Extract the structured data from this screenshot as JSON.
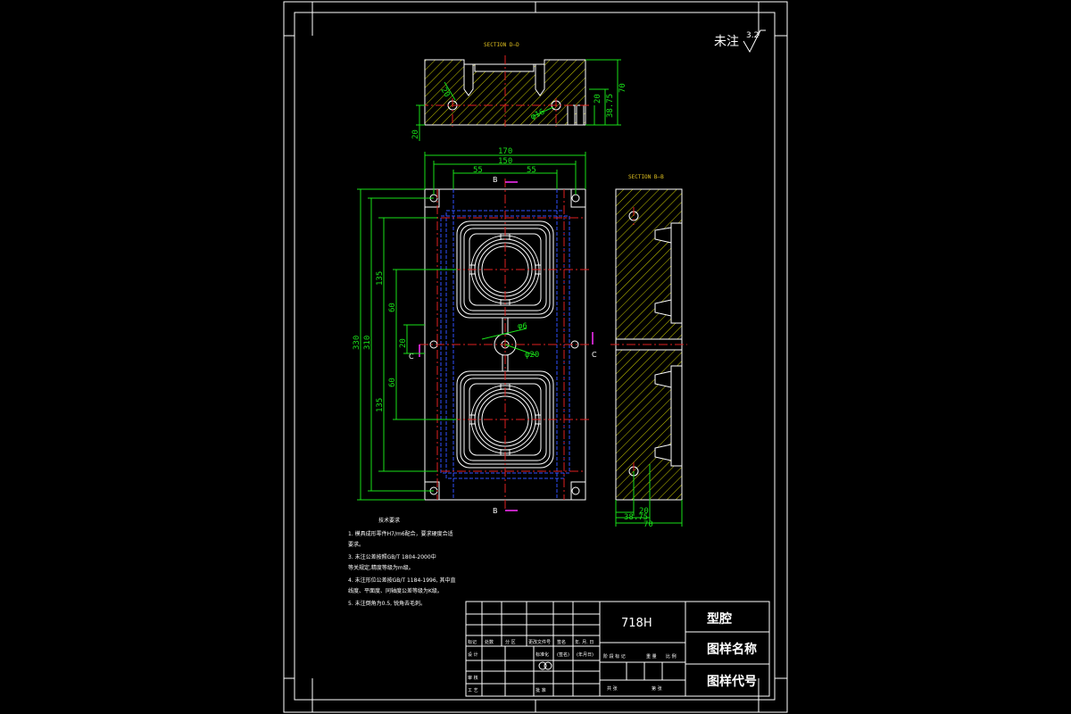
{
  "roughness": {
    "label": "未注",
    "value": "3.2"
  },
  "sections": {
    "dd": "SECTION D—D",
    "bb": "SECTION B—B"
  },
  "cut_marks": {
    "b": "B",
    "c": "C"
  },
  "dims": {
    "d170": "170",
    "d150": "150",
    "d55a": "55",
    "d55b": "55",
    "d330": "330",
    "d310": "310",
    "d135a": "135",
    "d135b": "135",
    "d60a": "60",
    "d60b": "60",
    "d20v": "20",
    "phi6": "φ6",
    "phi20": "φ20",
    "top70": "70",
    "top38": "38.75",
    "top20a": "20",
    "top20b": "20",
    "topphi": "φ16",
    "r20": "20",
    "bot20": "20",
    "bot38": "38.75",
    "bot70": "70"
  },
  "notes": {
    "title": "技术要求",
    "lines": [
      "1. 模具成形零件H7/m6配合，要求硬度合适",
      "   要求。",
      "3. 未注公差按照GB/T 1804-2000中",
      "   等关规定,精度等级为m级。",
      "4. 未注形位公差按GB/T 1184-1996, 其中直",
      "   线度、平面度、同轴度公差等级为K级。",
      "5. 未注倒角为0.5, 锐角去毛刺。"
    ]
  },
  "title_block": {
    "material": "718H",
    "part_name": "型腔",
    "drawing_name_label": "图样名称",
    "drawing_code_label": "图样代号",
    "header_row": [
      "标记",
      "处数",
      "分 区",
      "更改文件号",
      "签名",
      "年. 月. 日"
    ],
    "design": "设 计",
    "standardize": "标准化",
    "sign": "(签名)",
    "date": "(年月日)",
    "review": "审 核",
    "craft": "工 艺",
    "approve": "批 准",
    "stage_row": [
      "阶 段 标 记",
      "重 量",
      "比 例"
    ],
    "sheet_row": [
      "共 张",
      "第 张"
    ]
  }
}
